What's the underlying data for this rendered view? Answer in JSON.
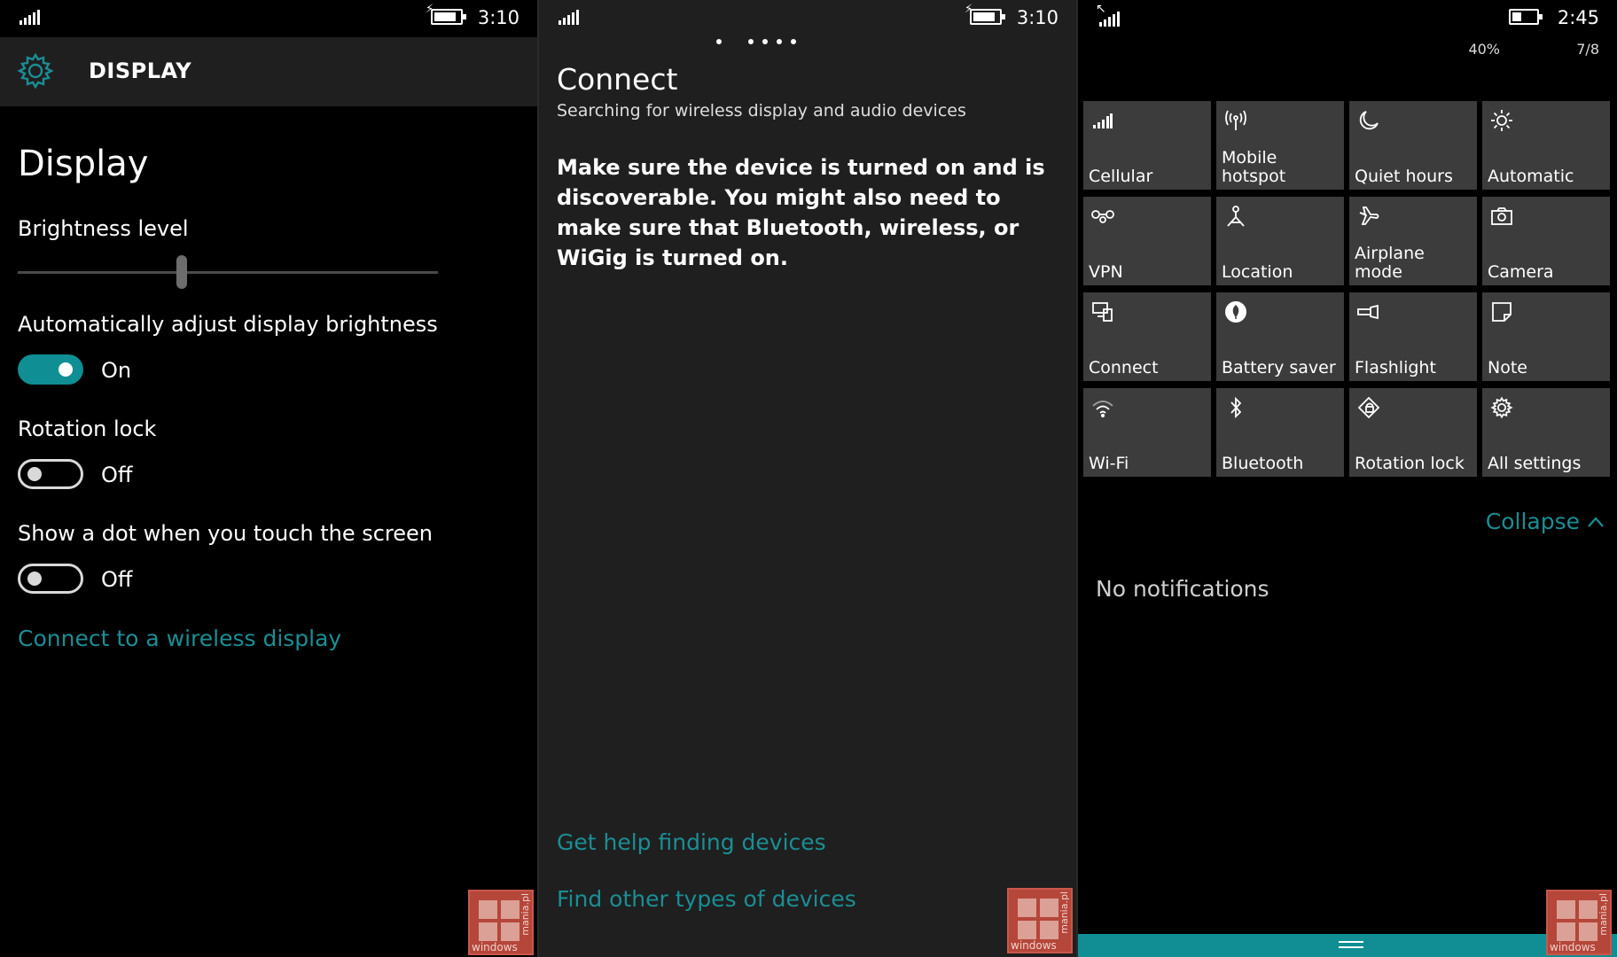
{
  "colors": {
    "accent": "#1a8e94",
    "tile": "#3c3c3c",
    "header": "#1f1f1f",
    "watermark": "#b5463a"
  },
  "display_settings": {
    "status": {
      "time": "3:10"
    },
    "header_title": "DISPLAY",
    "page_title": "Display",
    "brightness_label": "Brightness level",
    "brightness_level": 0.39,
    "auto_adjust_label": "Automatically adjust display brightness",
    "auto_adjust_state": "On",
    "rotation_lock_label": "Rotation lock",
    "rotation_lock_state": "Off",
    "touch_dot_label": "Show a dot when you touch the screen",
    "touch_dot_state": "Off",
    "wireless_link": "Connect to a wireless display",
    "icon": "gear-icon"
  },
  "connect": {
    "status": {
      "time": "3:10"
    },
    "title": "Connect",
    "subtitle": "Searching for wireless display and audio devices",
    "message": "Make sure the device is turned on and is discoverable. You might also need to make sure that Bluetooth, wireless, or WiGig is turned on.",
    "help_link": "Get help finding devices",
    "other_link": "Find other types of devices"
  },
  "action_center": {
    "status": {
      "time": "2:45",
      "battery": "40%",
      "date": "7/8"
    },
    "battery_level": 0.4,
    "tiles": [
      {
        "label": "Cellular",
        "icon": "cellular-icon"
      },
      {
        "label": "Mobile hotspot",
        "icon": "hotspot-icon"
      },
      {
        "label": "Quiet hours",
        "icon": "moon-icon"
      },
      {
        "label": "Automatic",
        "icon": "sun-icon"
      },
      {
        "label": "VPN",
        "icon": "vpn-icon"
      },
      {
        "label": "Location",
        "icon": "location-icon"
      },
      {
        "label": "Airplane mode",
        "icon": "airplane-icon"
      },
      {
        "label": "Camera",
        "icon": "camera-icon"
      },
      {
        "label": "Connect",
        "icon": "connect-icon"
      },
      {
        "label": "Battery saver",
        "icon": "battery-saver-icon"
      },
      {
        "label": "Flashlight",
        "icon": "flashlight-icon"
      },
      {
        "label": "Note",
        "icon": "note-icon"
      },
      {
        "label": "Wi-Fi",
        "icon": "wifi-icon"
      },
      {
        "label": "Bluetooth",
        "icon": "bluetooth-icon"
      },
      {
        "label": "Rotation lock",
        "icon": "rotation-lock-icon"
      },
      {
        "label": "All settings",
        "icon": "gear-icon"
      }
    ],
    "collapse_label": "Collapse",
    "no_notifications": "No notifications"
  },
  "watermark": {
    "word": "windows",
    "vertical": "mania.pl"
  }
}
